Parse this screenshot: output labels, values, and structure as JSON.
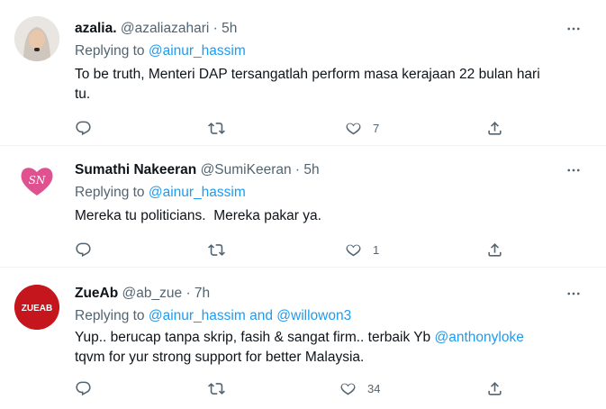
{
  "tweets": [
    {
      "name": "azalia.",
      "handle": "@azaliazahari",
      "sep": "·",
      "time": "5h",
      "replying_prefix": "Replying to ",
      "replying_to": [
        "@ainur_hassim"
      ],
      "text_lines": [
        "To be truth, Menteri DAP tersangatlah perform masa kerajaan 22 bulan hari",
        "tu."
      ],
      "replies": "",
      "retweets": "",
      "likes": "7",
      "avatar": {
        "type": "photo",
        "bg": "#e7e2dc"
      }
    },
    {
      "name": "Sumathi Nakeeran",
      "handle": "@SumiKeeran",
      "sep": "·",
      "time": "5h",
      "replying_prefix": "Replying to ",
      "replying_to": [
        "@ainur_hassim"
      ],
      "text_lines": [
        "Mereka tu politicians.  Mereka pakar ya."
      ],
      "replies": "",
      "retweets": "",
      "likes": "1",
      "avatar": {
        "type": "logo",
        "glyph": "SN",
        "color": "#e0528f"
      }
    },
    {
      "name": "ZueAb",
      "handle": "@ab_zue",
      "sep": "·",
      "time": "7h",
      "replying_prefix": "Replying to ",
      "replying_to": [
        "@ainur_hassim",
        "@willowon3"
      ],
      "replying_and": " and ",
      "text_before_mention": "Yup.. berucap tanpa skrip, fasih & sangat firm.. terbaik Yb ",
      "text_mention": "@anthonyloke",
      "text_line2": "tqvm for yur strong support for better Malaysia.",
      "replies": "",
      "retweets": "",
      "likes": "34",
      "avatar": {
        "type": "logo",
        "glyph": "ZUEAB",
        "color": "#c4161c"
      }
    }
  ],
  "colors": {
    "accent": "#1d9bf0",
    "muted": "#536471",
    "text": "#0f1419",
    "divider": "#eff3f4"
  },
  "icons": {
    "reply": "reply-icon",
    "retweet": "retweet-icon",
    "like": "like-icon",
    "share": "share-icon",
    "more": "more-icon"
  }
}
